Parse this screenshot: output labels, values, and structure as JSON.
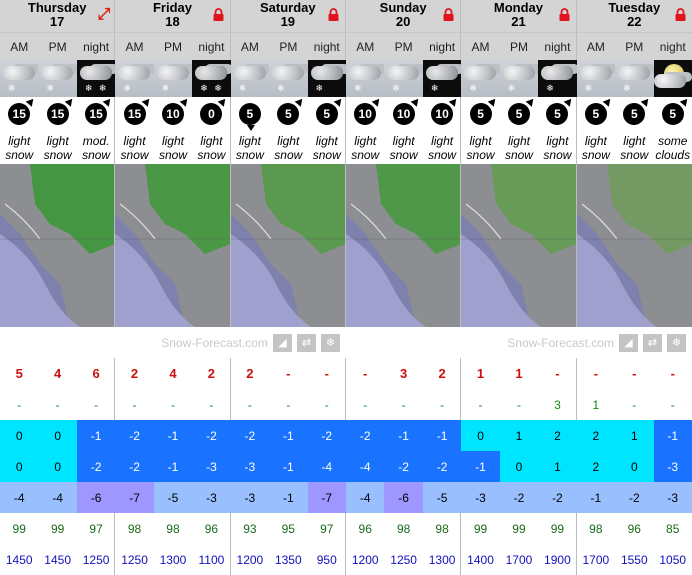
{
  "days": [
    {
      "name": "Thursday",
      "date": "17",
      "icon": "expand-icon"
    },
    {
      "name": "Friday",
      "date": "18",
      "icon": "lock-icon"
    },
    {
      "name": "Saturday",
      "date": "19",
      "icon": "lock-icon"
    },
    {
      "name": "Sunday",
      "date": "20",
      "icon": "lock-icon"
    },
    {
      "name": "Monday",
      "date": "21",
      "icon": "lock-icon"
    },
    {
      "name": "Tuesday",
      "date": "22",
      "icon": "lock-icon"
    }
  ],
  "periods": [
    "AM",
    "PM",
    "night"
  ],
  "wind": [
    "15",
    "15",
    "15",
    "15",
    "10",
    "0",
    "5",
    "5",
    "5",
    "10",
    "10",
    "10",
    "5",
    "5",
    "5",
    "5",
    "5",
    "5"
  ],
  "summary": [
    [
      "light",
      "snow"
    ],
    [
      "light",
      "snow"
    ],
    [
      "mod.",
      "snow"
    ],
    [
      "light",
      "snow"
    ],
    [
      "light",
      "snow"
    ],
    [
      "light",
      "snow"
    ],
    [
      "light",
      "snow"
    ],
    [
      "light",
      "snow"
    ],
    [
      "light",
      "snow"
    ],
    [
      "light",
      "snow"
    ],
    [
      "light",
      "snow"
    ],
    [
      "light",
      "snow"
    ],
    [
      "light",
      "snow"
    ],
    [
      "light",
      "snow"
    ],
    [
      "light",
      "snow"
    ],
    [
      "light",
      "snow"
    ],
    [
      "light",
      "snow"
    ],
    [
      "some",
      "clouds"
    ]
  ],
  "brand": "Snow-Forecast.com",
  "snow": [
    "5",
    "4",
    "6",
    "2",
    "4",
    "2",
    "2",
    "-",
    "-",
    "-",
    "3",
    "2",
    "1",
    "1",
    "-",
    "-",
    "-",
    "-"
  ],
  "rain": [
    "-",
    "-",
    "-",
    "-",
    "-",
    "-",
    "-",
    "-",
    "-",
    "-",
    "-",
    "-",
    "-",
    "-",
    "3",
    "1",
    "-",
    "-"
  ],
  "temp_max": [
    "0",
    "0",
    "-1",
    "-2",
    "-1",
    "-2",
    "-2",
    "-1",
    "-2",
    "-2",
    "-1",
    "-1",
    "0",
    "1",
    "2",
    "2",
    "1",
    "-1"
  ],
  "temp_min": [
    "0",
    "0",
    "-2",
    "-2",
    "-1",
    "-3",
    "-3",
    "-1",
    "-4",
    "-4",
    "-2",
    "-2",
    "-1",
    "0",
    "1",
    "2",
    "0",
    "-3"
  ],
  "wind_chill": [
    "-4",
    "-4",
    "-6",
    "-7",
    "-5",
    "-3",
    "-3",
    "-1",
    "-7",
    "-4",
    "-6",
    "-5",
    "-3",
    "-2",
    "-2",
    "-1",
    "-2",
    "-3"
  ],
  "humidity": [
    "99",
    "99",
    "97",
    "98",
    "98",
    "96",
    "93",
    "95",
    "97",
    "96",
    "98",
    "98",
    "99",
    "99",
    "99",
    "98",
    "96",
    "85"
  ],
  "freezing_level": [
    "1450",
    "1450",
    "1250",
    "1250",
    "1300",
    "1100",
    "1200",
    "1350",
    "950",
    "1200",
    "1250",
    "1300",
    "1400",
    "1700",
    "1900",
    "1700",
    "1550",
    "1050"
  ],
  "colors": {
    "header_bg": "#d4d4d4",
    "snow": "#cc1010",
    "rain": "#138a13",
    "freezing": "#1010c0",
    "temp_cyan": "#00e5ff",
    "temp_light": "#33b5ff",
    "temp_blue": "#1a73ff",
    "chill_light": "#99bfff",
    "chill_purple": "#9d97ff"
  }
}
